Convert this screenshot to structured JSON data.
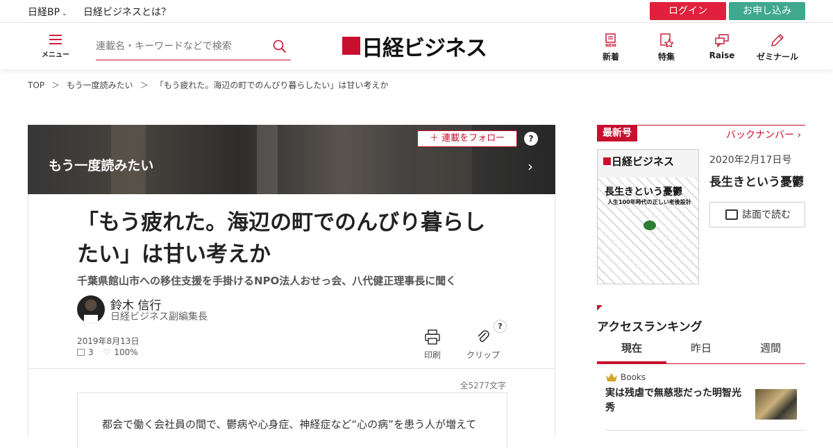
{
  "topbar": {
    "brand_menu": "日経BP",
    "about": "日経ビジネスとは？",
    "login": "ログイン",
    "apply": "お申し込み",
    "colors": {
      "login_bg": "#e0203c",
      "apply_bg": "#3fa88e"
    }
  },
  "header": {
    "menu_label": "メニュー",
    "search_placeholder": "連載名・キーワードなどで検索",
    "logo_text": "日経ビジネス",
    "nav": [
      {
        "label": "新着",
        "icon": "new-icon"
      },
      {
        "label": "特集",
        "icon": "feature-star-icon"
      },
      {
        "label": "Raise",
        "icon": "chat-icon"
      },
      {
        "label": "ゼミナール",
        "icon": "pen-icon"
      }
    ]
  },
  "breadcrumb": [
    "TOP",
    "もう一度読みたい",
    "「もう疲れた。海辺の町でのんびり暮らしたい」は甘い考えか"
  ],
  "breadcrumb_sep": "＞",
  "series": {
    "title": "もう一度読みたい",
    "follow": "連載をフォロー",
    "help": "?"
  },
  "article": {
    "headline": "「もう疲れた。海辺の町でのんびり暮らしたい」は甘い考えか",
    "subhead": "千葉県館山市への移住支援を手掛けるNPO法人おせっ会、八代健正理事長に聞く",
    "author_name": "鈴木 信行",
    "author_title": "日経ビジネス副編集長",
    "date": "2019年8月13日",
    "comments": "3",
    "likes": "100%",
    "print": "印刷",
    "clip": "クリップ",
    "help": "?",
    "char_count": "全5277文字",
    "body_first_line": "都会で働く会社員の間で、鬱病や心身症、神経症など“心の病”を患う人が増えて"
  },
  "sidebar": {
    "latest_badge": "最新号",
    "back_numbers": "バックナンバー",
    "cover_logo": "日経ビジネス",
    "cover_headline": "長生きという憂鬱",
    "cover_sub": "人生100年時代の正しい老後設計",
    "issue_date": "2020年2月17日号",
    "issue_title": "長生きという憂鬱",
    "read_button": "誌面で読む",
    "ranking_title": "アクセスランキング",
    "tabs": [
      "現在",
      "昨日",
      "週間"
    ],
    "active_tab": 0,
    "rank1": {
      "category": "Books",
      "title": "実は残虐で無慈悲だった明智光秀"
    }
  },
  "accent_color": "#c8102e"
}
